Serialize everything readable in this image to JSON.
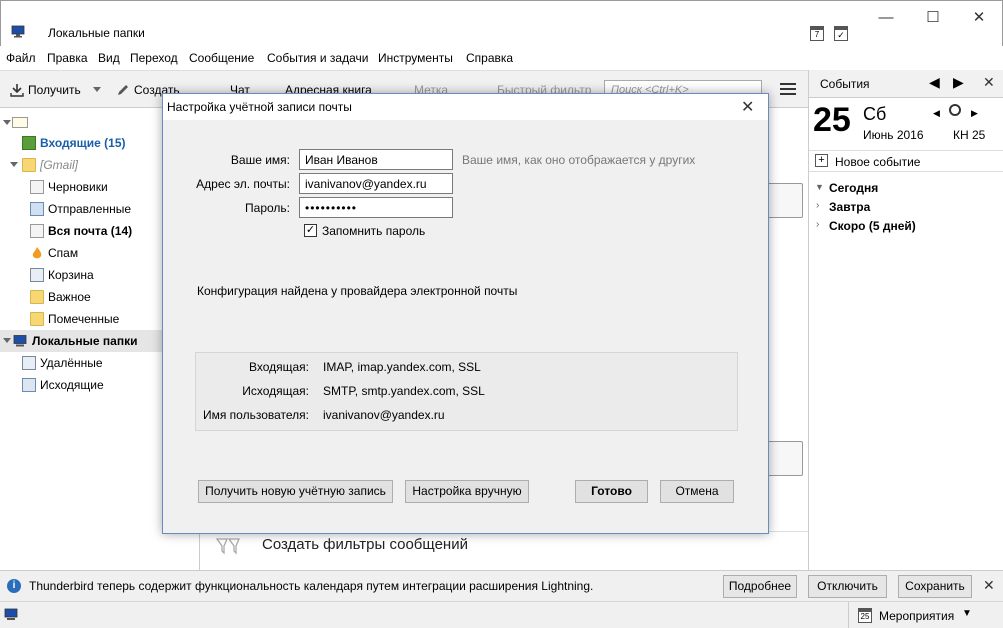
{
  "window": {
    "title": "Локальные папки",
    "minimize": "—",
    "maximize": "☐",
    "close": "✕"
  },
  "menu": [
    "Файл",
    "Правка",
    "Вид",
    "Переход",
    "Сообщение",
    "События и задачи",
    "Инструменты",
    "Справка"
  ],
  "toolbar": {
    "get": "Получить",
    "create": "Создать",
    "chat": "Чат",
    "addressbook": "Адресная книга",
    "tag": "Метка",
    "quickfilter": "Быстрый фильтр",
    "search_placeholder": "Поиск <Ctrl+K>"
  },
  "folders": {
    "inbox": "Входящие (15)",
    "gmail": "[Gmail]",
    "drafts": "Черновики",
    "sent": "Отправленные",
    "allmail": "Вся почта (14)",
    "spam": "Спам",
    "trash": "Корзина",
    "important": "Важное",
    "starred": "Помеченные",
    "local": "Локальные папки",
    "deleted": "Удалённые",
    "outbox": "Исходящие"
  },
  "center": {
    "filters": "Создать фильтры сообщений"
  },
  "events": {
    "header": "События",
    "day": "25",
    "weekday": "Сб",
    "month_year": "Июнь 2016",
    "week": "КН 25",
    "new_event": "Новое событие",
    "today": "Сегодня",
    "tomorrow": "Завтра",
    "soon": "Скоро (5 дней)"
  },
  "notification": {
    "text": "Thunderbird теперь содержит функциональность календаря путем интеграции расширения Lightning.",
    "more": "Подробнее",
    "disable": "Отключить",
    "keep": "Сохранить"
  },
  "statusbar": {
    "events_label": "Мероприятия",
    "calendar_day": "25"
  },
  "dialog": {
    "title": "Настройка учётной записи почты",
    "name_label": "Ваше имя:",
    "name_value": "Иван Иванов",
    "name_hint": "Ваше имя, как оно отображается у других",
    "email_label": "Адрес эл. почты:",
    "email_value": "ivanivanov@yandex.ru",
    "password_label": "Пароль:",
    "password_value": "••••••••••",
    "remember": "Запомнить пароль",
    "remember_checked": true,
    "found": "Конфигурация найдена у провайдера электронной почты",
    "incoming_label": "Входящая:",
    "incoming_value": "IMAP, imap.yandex.com, SSL",
    "outgoing_label": "Исходящая:",
    "outgoing_value": "SMTP, smtp.yandex.com, SSL",
    "username_label": "Имя пользователя:",
    "username_value": "ivanivanov@yandex.ru",
    "btn_new_account": "Получить новую учётную запись",
    "btn_manual": "Настройка вручную",
    "btn_done": "Готово",
    "btn_cancel": "Отмена"
  }
}
